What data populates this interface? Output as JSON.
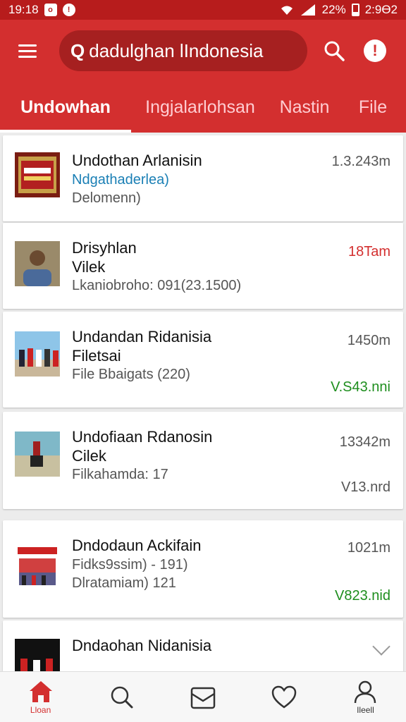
{
  "status_bar": {
    "time_left": "19:18",
    "battery_percent": "22%",
    "time_right": "2:9ϴ2"
  },
  "app_bar": {
    "search_text": "dadulghan lIndonesia",
    "search_prefix": "Q"
  },
  "tabs": [
    {
      "label": "Undowhan",
      "active": true
    },
    {
      "label": "Ingjalarlohsan",
      "active": false
    },
    {
      "label": "Nastin",
      "active": false
    },
    {
      "label": "File",
      "active": false
    }
  ],
  "list": [
    {
      "title": "Undothan Arlanisin",
      "line1": "Ndgathaderlea)",
      "line2": "Delomenn)",
      "meta_top": "1.3.243m",
      "meta_bottom": ""
    },
    {
      "title": "Drisyhlan",
      "line1": "Vilek",
      "line2": "Lkaniobroho: 091(23.1500)",
      "meta_top": "18Tam",
      "meta_bottom": ""
    },
    {
      "title": "Undandan Ridanisia",
      "line1": "Filetsai",
      "line2": "File Bbaigats (220)",
      "meta_top": "1450m",
      "meta_bottom": "V.S43.nni"
    },
    {
      "title": "Undofiaan Rdanosin",
      "line1": "Cilek",
      "line2": "Filkahamda: 17",
      "meta_top": "13342m",
      "meta_bottom": "V13.nrd"
    },
    {
      "title": "Dndodaun Ackifain",
      "line1": "Fidks9ssim) - 191)",
      "line2": "Dlratamiam) 121",
      "meta_top": "1021m",
      "meta_bottom": "V823.nid"
    },
    {
      "title": "Dndaohan Nidanisia",
      "line1": "",
      "line2": "",
      "meta_top": "",
      "meta_bottom": ""
    }
  ],
  "bottom_nav": [
    {
      "icon": "home-icon",
      "label": "Lloan"
    },
    {
      "icon": "search-icon",
      "label": ""
    },
    {
      "icon": "inbox-icon",
      "label": ""
    },
    {
      "icon": "heart-icon",
      "label": ""
    },
    {
      "icon": "profile-icon",
      "label": "Ileell"
    }
  ],
  "colors": {
    "primary": "#d32f2f",
    "status_bar": "#b71c1c",
    "accent_blue": "#1a7fb5",
    "accent_green": "#1e8e1e"
  }
}
